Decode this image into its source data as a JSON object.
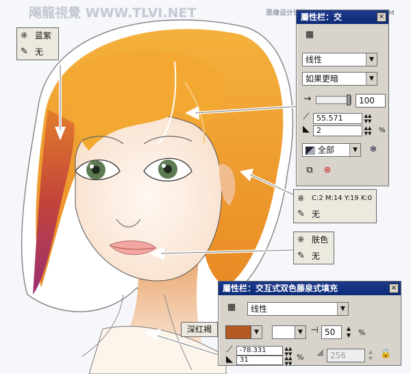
{
  "watermark_left": "飚龍視覺 WWW.TLVI.NET",
  "watermark_right": "思缘设计论坛 WWW.MISSYUAN.COM",
  "right_panel": {
    "title": "屬性栏：交",
    "fill_type": "线性",
    "blend_mode": "如果更暗",
    "opacity_value": "100",
    "angle_value": "55.571",
    "edge_value": "2",
    "percent_unit": "%",
    "apply_to": "全部"
  },
  "callouts": {
    "hair_tip": {
      "color": "蓝紫",
      "outline": "无"
    },
    "ear": {
      "color": "C:2 M:14 Y:19 K:0",
      "outline": "无"
    },
    "lips": {
      "color": "肤色",
      "outline": "无"
    }
  },
  "bottom_panel": {
    "title": "屬性栏：交互式双色藤泉式填充",
    "fill_type": "线性",
    "color_label": "深红褐",
    "midpoint_value": "50",
    "percent_unit": "%",
    "angle_value": "-78.331",
    "edge_value": "31",
    "steps_value": "256"
  },
  "colors": {
    "hair_orange": "#f0a030",
    "hair_dark": "#c94c2c",
    "hair_purple": "#a2366e",
    "skin": "#fbe7d6",
    "deep_brown": "#b35a22",
    "titlebar_blue": "#0b2b78"
  }
}
